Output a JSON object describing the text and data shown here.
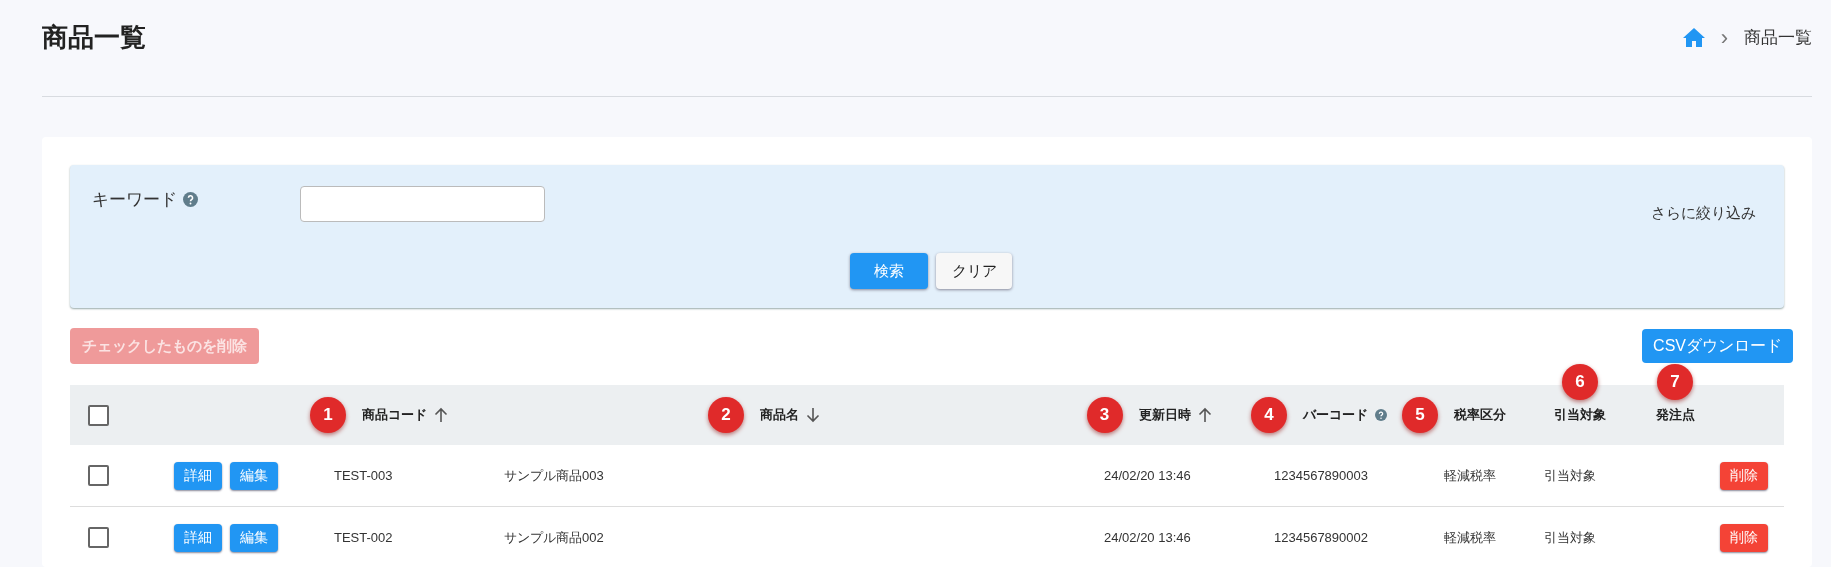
{
  "page": {
    "title": "商品一覧"
  },
  "breadcrumb": {
    "separator": "›",
    "current": "商品一覧"
  },
  "search": {
    "keyword_label": "キーワード",
    "keyword_help": true,
    "more_filters": "さらに絞り込み",
    "buttons": [
      {
        "label": "検索",
        "kind": "primary"
      },
      {
        "label": "クリア",
        "kind": "plain"
      }
    ]
  },
  "actions": {
    "delete_checked": {
      "label": "チェックしたものを削除",
      "disabled": true
    },
    "csv_download": {
      "label": "CSVダウンロード"
    }
  },
  "table": {
    "select_all": {
      "checked": false
    },
    "columns": [
      {
        "label": "商品コード",
        "marker": "1",
        "sort_ascending": true,
        "sort_descending": false,
        "help": false
      },
      {
        "label": "商品名",
        "marker": "2",
        "sort_ascending": false,
        "sort_descending": true,
        "help": false
      },
      {
        "label": "更新日時",
        "marker": "3",
        "sort_ascending": true,
        "sort_descending": false,
        "help": false
      },
      {
        "label": "バーコード",
        "marker": "4",
        "sort_ascending": false,
        "sort_descending": false,
        "help": true
      },
      {
        "label": "税率区分",
        "marker": "5",
        "sort_ascending": false,
        "sort_descending": false,
        "help": false
      },
      {
        "label": "引当対象",
        "marker": "6",
        "sort_ascending": false,
        "sort_descending": false,
        "help": false
      },
      {
        "label": "発注点",
        "marker": "7",
        "sort_ascending": false,
        "sort_descending": false,
        "help": false
      }
    ],
    "rows": [
      {
        "checked": false,
        "buttons": [
          "詳細",
          "編集"
        ],
        "cells": [
          "TEST-003",
          "サンプル商品003",
          "24/02/20 13:46",
          "1234567890003",
          "軽減税率",
          "引当対象",
          ""
        ],
        "delete": "削除"
      },
      {
        "checked": false,
        "buttons": [
          "詳細",
          "編集"
        ],
        "cells": [
          "TEST-002",
          "サンプル商品002",
          "24/02/20 13:46",
          "1234567890002",
          "軽減税率",
          "引当対象",
          ""
        ],
        "delete": "削除"
      }
    ]
  }
}
